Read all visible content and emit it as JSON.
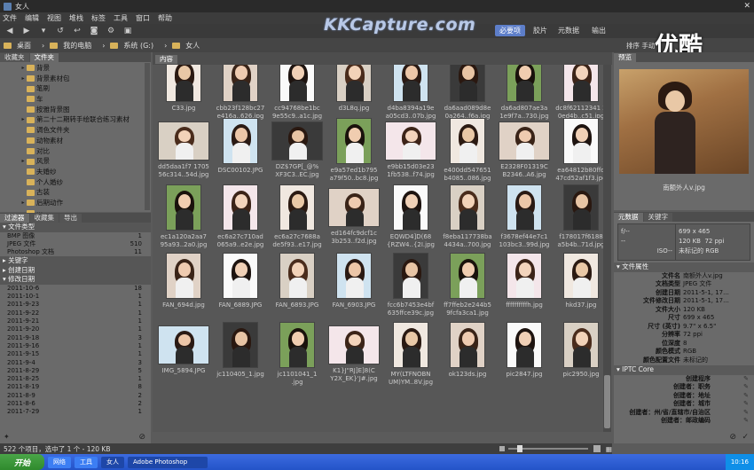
{
  "window": {
    "title": "女人"
  },
  "menu": [
    "文件",
    "编辑",
    "视图",
    "堆栈",
    "标签",
    "工具",
    "窗口",
    "帮助"
  ],
  "watermark": "KKCapture.com",
  "workspaces": [
    {
      "label": "必要项",
      "active": true
    },
    {
      "label": "胶片",
      "active": false
    },
    {
      "label": "元数据",
      "active": false
    },
    {
      "label": "输出",
      "active": false
    }
  ],
  "youku": "优酷",
  "path": [
    "桌面",
    "我的电脑",
    "系统 (G:)",
    "女人"
  ],
  "sort": {
    "label": "排序",
    "manual": "手动"
  },
  "left_tabs": [
    "收藏夹",
    "文件夹"
  ],
  "folders": [
    {
      "label": "背景",
      "tri": "▸"
    },
    {
      "label": "背景素材包",
      "tri": "▸"
    },
    {
      "label": "笔刷",
      "tri": ""
    },
    {
      "label": "车",
      "tri": ""
    },
    {
      "label": "按雅背景图",
      "tri": ""
    },
    {
      "label": "第二十二期转手绘联合练习素材",
      "tri": "▸"
    },
    {
      "label": "调色文件夹",
      "tri": ""
    },
    {
      "label": "动物素材",
      "tri": ""
    },
    {
      "label": "对比",
      "tri": ""
    },
    {
      "label": "风景",
      "tri": "▸"
    },
    {
      "label": "夫婚纱",
      "tri": ""
    },
    {
      "label": "个人婚纱",
      "tri": ""
    },
    {
      "label": "古装",
      "tri": ""
    },
    {
      "label": "后期动作",
      "tri": "▸"
    },
    {
      "label": "···",
      "tri": ""
    }
  ],
  "filter_tabs": [
    "过滤器",
    "收藏集",
    "导出"
  ],
  "filters": {
    "file_type_label": "文件类型",
    "file_types": [
      {
        "name": "BMP 图像",
        "count": "1"
      },
      {
        "name": "JPEG 文件",
        "count": "510"
      },
      {
        "name": "Photoshop 文档",
        "count": "11"
      }
    ],
    "keywords_label": "关键字",
    "created_label": "创建日期",
    "modified_label": "修改日期",
    "dates": [
      {
        "d": "2011-10-6",
        "c": "18"
      },
      {
        "d": "2011-10-1",
        "c": "1"
      },
      {
        "d": "2011-9-23",
        "c": "1"
      },
      {
        "d": "2011-9-22",
        "c": "1"
      },
      {
        "d": "2011-9-21",
        "c": "1"
      },
      {
        "d": "2011-9-20",
        "c": "1"
      },
      {
        "d": "2011-9-18",
        "c": "3"
      },
      {
        "d": "2011-9-16",
        "c": "1"
      },
      {
        "d": "2011-9-15",
        "c": "1"
      },
      {
        "d": "2011-9-4",
        "c": "3"
      },
      {
        "d": "2011-8-29",
        "c": "5"
      },
      {
        "d": "2011-8-25",
        "c": "1"
      },
      {
        "d": "2011-8-19",
        "c": "8"
      },
      {
        "d": "2011-8-9",
        "c": "2"
      },
      {
        "d": "2011-8-6",
        "c": "2"
      },
      {
        "d": "2011-7-29",
        "c": "1"
      }
    ]
  },
  "content": {
    "tab": "内容",
    "rows": [
      [
        "C33.jpg",
        "cbb23f128bc27\ne416a..626.jpg",
        "cc94768be1bc\n9e55c9..a1c.jpg",
        "d3L8q.jpg",
        "d4ba8394a19e\na05cd3..07b.jpg",
        "da6aad089d8e\n0a264..f6a.jpg",
        "da6ad807ae3a\n1e9f7a..730.jpg",
        "dc8f62112341 2\n0ed4b..c51.jpg"
      ],
      [
        "dd5daa1f7 1705\n56c314..54d.jpg",
        "DSC00102.JPG",
        "DZ$7GP[_@%\nXF3C3..EC.jpg",
        "e9a57ed1b795\na79f50..bc8.jpg",
        "e9bb15d03e23\n1fb538..f74.jpg",
        "e400dd547651\nb4085..086.jpg",
        "E2328F01319C\nB2346..A6.jpg",
        "ea64812b80ffd\n47cd52af1f3.jpg"
      ],
      [
        "ec1a120a2aa7\n95a93..2a0.jpg",
        "ec6a27c710ad\n065a9..e2e.jpg",
        "ec6a27c7688a\nde5f93..e17.jpg",
        "ed164fc9dcf1c\n3b253..f2d.jpg",
        "EQWD4]D(68\n{RZW4..{2I.jpg",
        "f8eba117738ba\n4434a..700.jpg",
        "f3678ef44e7c1\n103bc3..99d.jpg",
        "f178017f6188\na5b4b..71d.jpg"
      ],
      [
        "FAN_694d.jpg",
        "FAN_6889.JPG",
        "FAN_6893.JPG",
        "FAN_6903.JPG",
        "fcc6b7453e4bf\n635ffce39c.jpg",
        "ff7ffeb2e244b5\n9fcfa3ca1.jpg",
        "ffffffffffh.jpg",
        "hkd37.jpg"
      ],
      [
        "IMG_5894.JPG",
        "jc110405_1.jpg",
        "jc1101041_1\n.jpg",
        "K1}J\"RJ]E]8(C\nY2X_EK}'J#.jpg",
        "MY(LTFNOBN\nUM)YM..8V.jpg",
        "ok123ds.jpg",
        "pic2847.jpg",
        "pic2950.jpg"
      ]
    ]
  },
  "status": {
    "text": "522 个项目，选中了 1 个 - 120 KB"
  },
  "preview": {
    "tab": "预览",
    "caption": "南额外人v.jpg"
  },
  "meta_tabs": [
    "元数据",
    "关键字"
  ],
  "meta_header": {
    "ap": "f/--",
    "ss": "--",
    "iso": "ISO--",
    "dims": "699 x 465",
    "size": "120 KB",
    "ppi": "72 ppi",
    "color": "未标记的 RGB"
  },
  "file_props_label": "文件属性",
  "file_props": [
    {
      "k": "文件名",
      "v": "南额外人v.jpg"
    },
    {
      "k": "文档类型",
      "v": "JPEG 文件"
    },
    {
      "k": "创建日期",
      "v": "2011-5-1, 17..."
    },
    {
      "k": "文件修改日期",
      "v": "2011-5-1, 17..."
    },
    {
      "k": "文件大小",
      "v": "120 KB"
    },
    {
      "k": "尺寸",
      "v": "699 x 465"
    },
    {
      "k": "尺寸 (英寸)",
      "v": "9.7\" x 6.5\""
    },
    {
      "k": "分辨率",
      "v": "72 ppi"
    },
    {
      "k": "位深度",
      "v": "8"
    },
    {
      "k": "颜色模式",
      "v": "RGB"
    },
    {
      "k": "颜色配置文件",
      "v": "未标记的"
    }
  ],
  "iptc_label": "IPTC Core",
  "iptc": [
    "创建程序",
    "创建者：职务",
    "创建者：地址",
    "创建者：城市",
    "创建者：州/省/直辖市/自治区",
    "创建者：邮政编码"
  ],
  "taskbar": {
    "start": "开始",
    "items": [
      "网络",
      "工具",
      "女人",
      "Adobe Photoshop"
    ],
    "clock": "10:16"
  },
  "colors": {
    "accent": "#5d7ec9",
    "panel": "#6a6a6a",
    "content": "#575757"
  }
}
